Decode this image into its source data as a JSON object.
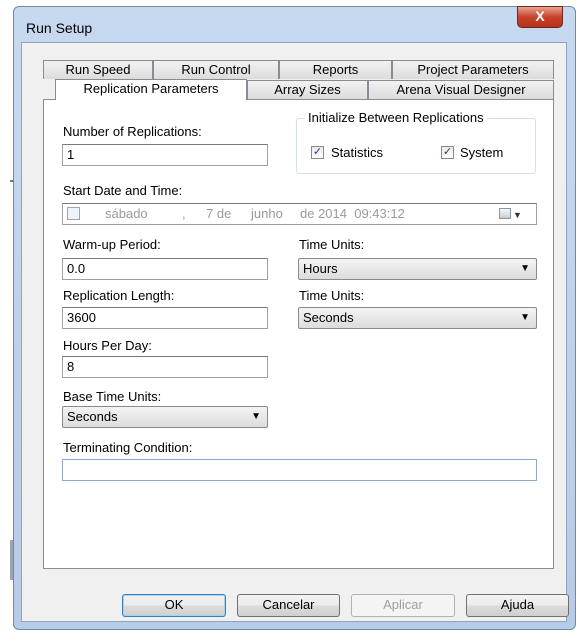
{
  "dialog": {
    "title": "Run Setup",
    "close_label": "X"
  },
  "tabs": {
    "row1": [
      "Run Speed",
      "Run Control",
      "Reports",
      "Project Parameters"
    ],
    "row2": [
      "Replication Parameters",
      "Array Sizes",
      "Arena Visual Designer"
    ],
    "active": "Replication Parameters"
  },
  "form": {
    "num_replications_label": "Number of Replications:",
    "num_replications_value": "1",
    "init_group_label": "Initialize Between Replications",
    "statistics_label": "Statistics",
    "statistics_checked": true,
    "system_label": "System",
    "system_checked": true,
    "start_date_label": "Start Date and Time:",
    "start_date": {
      "weekday": "sábado",
      "sep": ",",
      "day": "7 de",
      "month": "junho",
      "year_time": "de 2014  09:43:12"
    },
    "warmup_label": "Warm-up Period:",
    "warmup_value": "0.0",
    "time_units_label_1": "Time Units:",
    "time_units_value_1": "Hours",
    "rep_length_label": "Replication Length:",
    "rep_length_value": "3600",
    "time_units_label_2": "Time Units:",
    "time_units_value_2": "Seconds",
    "hours_per_day_label": "Hours Per Day:",
    "hours_per_day_value": "8",
    "base_time_units_label": "Base Time Units:",
    "base_time_units_value": "Seconds",
    "terminating_label": "Terminating Condition:",
    "terminating_value": ""
  },
  "buttons": {
    "ok": "OK",
    "cancel": "Cancelar",
    "apply": "Aplicar",
    "help": "Ajuda"
  },
  "icons": {
    "check": "✓",
    "dropdown": "▼",
    "calendar": "calendar-icon"
  }
}
